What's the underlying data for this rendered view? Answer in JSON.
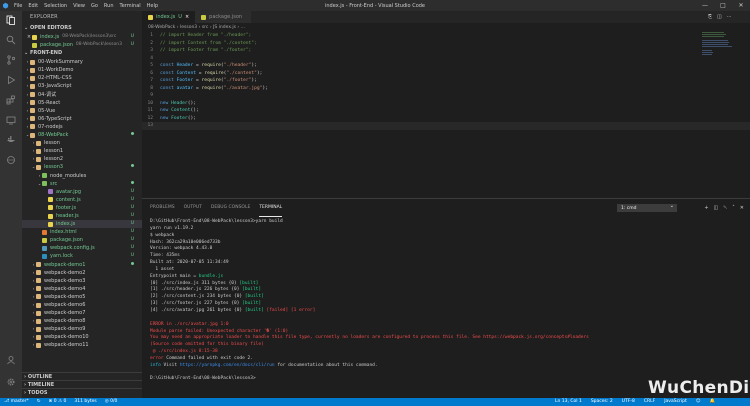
{
  "titlebar": {
    "menu": [
      "File",
      "Edit",
      "Selection",
      "View",
      "Go",
      "Run",
      "Terminal",
      "Help"
    ],
    "title": "index.js - Front-End - Visual Studio Code",
    "controls": [
      "—",
      "□",
      "✕"
    ]
  },
  "activity_bar": {
    "items": [
      "explorer-icon",
      "search-icon",
      "source-control-icon",
      "run-debug-icon",
      "extensions-icon",
      "remote-icon",
      "docker-icon",
      "browser-icon",
      "account-icon",
      "settings-icon"
    ]
  },
  "sidebar": {
    "title": "EXPLORER",
    "open_editors": {
      "title": "OPEN EDITORS",
      "items": [
        {
          "close": "×",
          "name": "index.js",
          "path": "08-WebPack\\lesson3\\src",
          "status": "U"
        },
        {
          "close": "",
          "name": "package.json",
          "path": "08-WebPack\\lesson3",
          "status": "U"
        }
      ]
    },
    "workspace": {
      "title": "FRONT-END",
      "items": [
        {
          "name": "00-WorkSummary",
          "arrow": "›",
          "indent": 0,
          "icon": "folder",
          "status": ""
        },
        {
          "name": "01-WorkDemo",
          "arrow": "›",
          "indent": 0,
          "icon": "folder",
          "status": ""
        },
        {
          "name": "02-HTML-CSS",
          "arrow": "›",
          "indent": 0,
          "icon": "folder",
          "status": ""
        },
        {
          "name": "03-JavaScript",
          "arrow": "›",
          "indent": 0,
          "icon": "folder",
          "status": ""
        },
        {
          "name": "04-调试",
          "arrow": "›",
          "indent": 0,
          "icon": "folder",
          "status": ""
        },
        {
          "name": "05-React",
          "arrow": "›",
          "indent": 0,
          "icon": "folder",
          "status": ""
        },
        {
          "name": "05-Vue",
          "arrow": "›",
          "indent": 0,
          "icon": "folder",
          "status": ""
        },
        {
          "name": "06-TypeScript",
          "arrow": "›",
          "indent": 0,
          "icon": "folder",
          "status": ""
        },
        {
          "name": "07-nodejs",
          "arrow": "›",
          "indent": 0,
          "icon": "folder",
          "status": ""
        },
        {
          "name": "08-WebPack",
          "arrow": "⌄",
          "indent": 0,
          "icon": "folder",
          "status": "dot"
        },
        {
          "name": "lesson",
          "arrow": "›",
          "indent": 1,
          "icon": "folder",
          "status": ""
        },
        {
          "name": "lesson1",
          "arrow": "›",
          "indent": 1,
          "icon": "folder",
          "status": ""
        },
        {
          "name": "lesson2",
          "arrow": "›",
          "indent": 1,
          "icon": "folder",
          "status": ""
        },
        {
          "name": "lesson3",
          "arrow": "⌄",
          "indent": 1,
          "icon": "folder",
          "status": "dot"
        },
        {
          "name": "node_modules",
          "arrow": "›",
          "indent": 2,
          "icon": "fold-green",
          "status": ""
        },
        {
          "name": "src",
          "arrow": "⌄",
          "indent": 2,
          "icon": "fold-green",
          "status": "dot"
        },
        {
          "name": "avatar.jpg",
          "arrow": "",
          "indent": 3,
          "icon": "img",
          "status": "U"
        },
        {
          "name": "content.js",
          "arrow": "",
          "indent": 3,
          "icon": "js",
          "status": "U"
        },
        {
          "name": "footer.js",
          "arrow": "",
          "indent": 3,
          "icon": "js",
          "status": "U"
        },
        {
          "name": "header.js",
          "arrow": "",
          "indent": 3,
          "icon": "js",
          "status": "U"
        },
        {
          "name": "index.js",
          "arrow": "",
          "indent": 3,
          "icon": "js",
          "status": "U",
          "selected": true
        },
        {
          "name": "index.html",
          "arrow": "",
          "indent": 2,
          "icon": "html",
          "status": "U"
        },
        {
          "name": "package.json",
          "arrow": "",
          "indent": 2,
          "icon": "json",
          "status": "U"
        },
        {
          "name": "webpack.config.js",
          "arrow": "",
          "indent": 2,
          "icon": "cfg",
          "status": "U"
        },
        {
          "name": "yarn.lock",
          "arrow": "",
          "indent": 2,
          "icon": "yarn",
          "status": "U"
        },
        {
          "name": "webpack-demo1",
          "arrow": "›",
          "indent": 1,
          "icon": "folder",
          "status": "dot"
        },
        {
          "name": "webpack-demo2",
          "arrow": "›",
          "indent": 1,
          "icon": "folder",
          "status": ""
        },
        {
          "name": "webpack-demo3",
          "arrow": "›",
          "indent": 1,
          "icon": "folder",
          "status": ""
        },
        {
          "name": "webpack-demo4",
          "arrow": "›",
          "indent": 1,
          "icon": "folder",
          "status": ""
        },
        {
          "name": "webpack-demo5",
          "arrow": "›",
          "indent": 1,
          "icon": "folder",
          "status": ""
        },
        {
          "name": "webpack-demo6",
          "arrow": "›",
          "indent": 1,
          "icon": "folder",
          "status": ""
        },
        {
          "name": "webpack-demo7",
          "arrow": "›",
          "indent": 1,
          "icon": "folder",
          "status": ""
        },
        {
          "name": "webpack-demo8",
          "arrow": "›",
          "indent": 1,
          "icon": "folder",
          "status": ""
        },
        {
          "name": "webpack-demo9",
          "arrow": "›",
          "indent": 1,
          "icon": "folder",
          "status": ""
        },
        {
          "name": "webpack-demo10",
          "arrow": "›",
          "indent": 1,
          "icon": "folder",
          "status": ""
        },
        {
          "name": "webpack-demo11",
          "arrow": "›",
          "indent": 1,
          "icon": "folder",
          "status": ""
        }
      ]
    },
    "bottom_sections": [
      "OUTLINE",
      "TIMELINE",
      "TODOS"
    ]
  },
  "tabs": [
    {
      "label": "index.js",
      "status": "U",
      "active": true,
      "icon": "js"
    },
    {
      "label": "package.json",
      "status": "",
      "active": false,
      "icon": "json"
    }
  ],
  "tab_actions": [
    "⎘",
    "◫",
    "⋯"
  ],
  "breadcrumb": "08-WebPack › lesson3 › src › JS index.js › ...",
  "code": [
    [
      [
        "tk-cmt",
        "// import Header from \"./header\";"
      ]
    ],
    [
      [
        "tk-cmt",
        "// import Content from \"./content\";"
      ]
    ],
    [
      [
        "tk-cmt",
        "// import Footer from \"./footer\";"
      ]
    ],
    [],
    [
      [
        "tk-kw",
        "const "
      ],
      [
        "tk-var",
        "Header"
      ],
      [
        "tk-p",
        " = "
      ],
      [
        "tk-fn",
        "require"
      ],
      [
        "tk-p",
        "("
      ],
      [
        "tk-str",
        "\"./header\""
      ],
      [
        "tk-p",
        ");"
      ]
    ],
    [
      [
        "tk-kw",
        "const "
      ],
      [
        "tk-var",
        "Content"
      ],
      [
        "tk-p",
        " = "
      ],
      [
        "tk-fn",
        "require"
      ],
      [
        "tk-p",
        "("
      ],
      [
        "tk-str",
        "\"./content\""
      ],
      [
        "tk-p",
        ");"
      ]
    ],
    [
      [
        "tk-kw",
        "const "
      ],
      [
        "tk-var",
        "Footer"
      ],
      [
        "tk-p",
        " = "
      ],
      [
        "tk-fn",
        "require"
      ],
      [
        "tk-p",
        "("
      ],
      [
        "tk-str",
        "\"./footer\""
      ],
      [
        "tk-p",
        ");"
      ]
    ],
    [
      [
        "tk-kw",
        "const "
      ],
      [
        "tk-var",
        "avatar"
      ],
      [
        "tk-p",
        " = "
      ],
      [
        "tk-fn",
        "require"
      ],
      [
        "tk-p",
        "("
      ],
      [
        "tk-str",
        "\"./avatar.jpg\""
      ],
      [
        "tk-p",
        ");"
      ]
    ],
    [],
    [
      [
        "tk-kw",
        "new "
      ],
      [
        "tk-cls",
        "Header"
      ],
      [
        "tk-p",
        "();"
      ]
    ],
    [
      [
        "tk-kw",
        "new "
      ],
      [
        "tk-cls",
        "Content"
      ],
      [
        "tk-p",
        "();"
      ]
    ],
    [
      [
        "tk-kw",
        "new "
      ],
      [
        "tk-cls",
        "Footer"
      ],
      [
        "tk-p",
        "();"
      ]
    ],
    []
  ],
  "panel": {
    "tabs": [
      "PROBLEMS",
      "OUTPUT",
      "DEBUG CONSOLE",
      "TERMINAL"
    ],
    "active_tab": "TERMINAL",
    "terminal_select": "1: cmd",
    "tools": [
      "+",
      "◫",
      "␡",
      "˄",
      "✕"
    ],
    "terminal_lines": [
      [
        [
          "",
          "D:\\GitHub\\Front-End\\08-WebPack\\lesson3>yarn build"
        ]
      ],
      [
        [
          "",
          "yarn run v1.19.2"
        ]
      ],
      [
        [
          "",
          "$ webpack"
        ]
      ],
      [
        [
          "",
          "Hash: 362ca29a10e006ed733b"
        ]
      ],
      [
        [
          "",
          "Version: webpack 4.43.0"
        ]
      ],
      [
        [
          "",
          "Time: 435ms"
        ]
      ],
      [
        [
          "",
          "Built at: 2020-07-05 11:34:49"
        ]
      ],
      [
        [
          "",
          "  1 asset"
        ]
      ],
      [
        [
          "",
          "Entrypoint main = "
        ],
        [
          "t-green",
          "bundle.js"
        ]
      ],
      [
        [
          "",
          "[0] ./src/index.js 311 bytes {0} "
        ],
        [
          "t-green",
          "[built]"
        ]
      ],
      [
        [
          "",
          "[1] ./src/header.js 226 bytes {0} "
        ],
        [
          "t-green",
          "[built]"
        ]
      ],
      [
        [
          "",
          "[2] ./src/content.js 234 bytes {0} "
        ],
        [
          "t-green",
          "[built]"
        ]
      ],
      [
        [
          "",
          "[3] ./src/footer.js 227 bytes {0} "
        ],
        [
          "t-green",
          "[built]"
        ]
      ],
      [
        [
          "",
          "[4] ./src/avatar.jpg 261 bytes {0} "
        ],
        [
          "t-green",
          "[built]"
        ],
        [
          "",
          " "
        ],
        [
          "t-red",
          "[failed] [1 error]"
        ]
      ],
      [],
      [
        [
          "t-red",
          "ERROR in ./src/avatar.jpg 1:0"
        ]
      ],
      [
        [
          "t-red",
          "Module parse failed: Unexpected character '�' (1:0)"
        ]
      ],
      [
        [
          "t-red",
          "You may need an appropriate loader to handle this file type, currently no loaders are configured to process this file. See https://webpack.js.org/concepts#loaders"
        ]
      ],
      [
        [
          "t-red",
          "(Source code omitted for this binary file)"
        ]
      ],
      [
        [
          "t-red",
          " @ ./src/index.js 8:15-38"
        ]
      ],
      [
        [
          "t-red",
          "error"
        ],
        [
          "",
          " Command failed with exit code 2."
        ]
      ],
      [
        [
          "t-cyan",
          "info"
        ],
        [
          "",
          " Visit "
        ],
        [
          "t-link",
          "https://yarnpkg.com/en/docs/cli/run"
        ],
        [
          "",
          " for documentation about this command."
        ]
      ],
      [],
      [
        [
          "",
          "D:\\GitHub\\Front-End\\08-WebPack\\lesson3>"
        ]
      ]
    ]
  },
  "statusbar": {
    "left": [
      "⎇ master*",
      "↻",
      "⊗ 0 ⚠ 0",
      "311 bytes",
      "◎ 0/0"
    ],
    "right": [
      "Ln 13, Col 1",
      "Spaces: 2",
      "UTF-8",
      "CRLF",
      "JavaScript",
      "☺",
      "🔔"
    ]
  },
  "watermark": "WuChenDi"
}
